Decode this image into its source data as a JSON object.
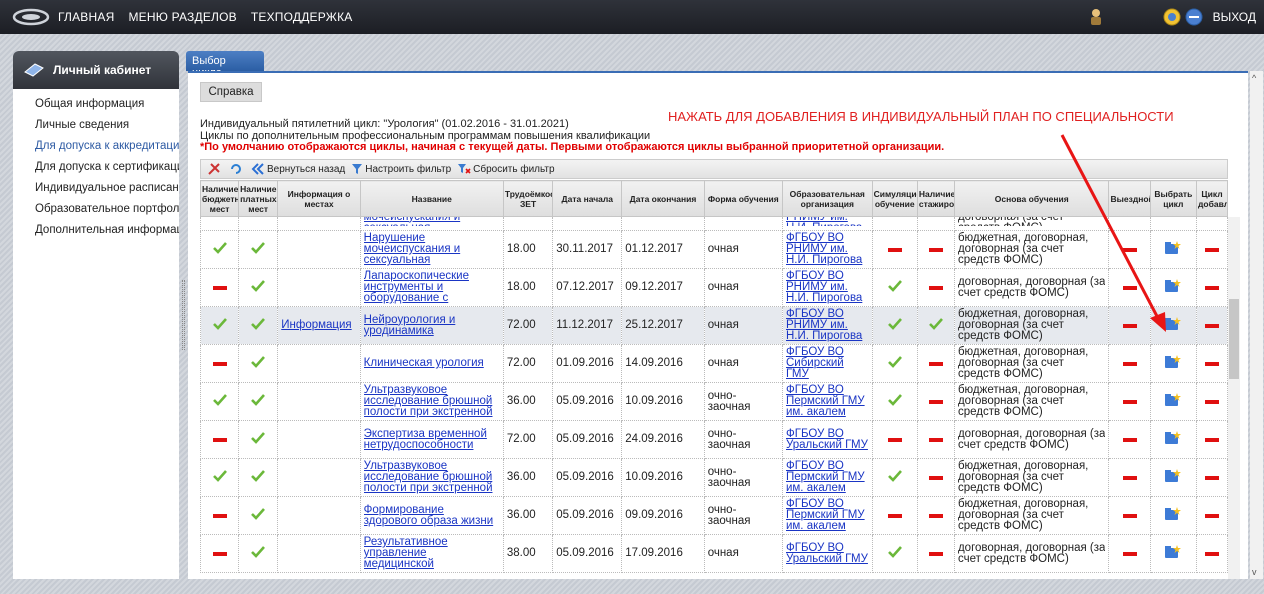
{
  "topbar": {
    "nav": [
      "ГЛАВНАЯ",
      "МЕНЮ РАЗДЕЛОВ",
      "ТЕХПОДДЕРЖКА"
    ],
    "exit_label": "ВЫХОД"
  },
  "sidebar": {
    "title": "Личный кабинет",
    "items": [
      "Общая информация",
      "Личные сведения",
      "Для допуска к аккредитации",
      "Для допуска к сертификации",
      "Индивидуальное расписание",
      "Образовательное портфолио",
      "Дополнительная информация"
    ],
    "active_index": 2
  },
  "tab": {
    "label": "Выбор цикла"
  },
  "help_button": "Справка",
  "info": {
    "line1": "Индивидуальный пятилетний цикл: \"Урология\" (01.02.2016 - 31.01.2021)",
    "line2": "Циклы по дополнительным профессиональным программам повышения квалификации",
    "warning": "*По умолчанию отображаются циклы, начиная с текущей даты. Первыми отображаются циклы выбранной приоритетной организации."
  },
  "annotation": "НАЖАТЬ ДЛЯ ДОБАВЛЕНИЯ В ИНДИВИДУАЛЬНЫЙ ПЛАН ПО СПЕЦИАЛЬНОСТИ",
  "toolbar": {
    "back": "Вернуться назад",
    "filter": "Настроить фильтр",
    "reset": "Сбросить фильтр"
  },
  "columns": [
    "Наличие бюджетных мест",
    "Наличие платных мест",
    "Информация о местах",
    "Название",
    "Трудоёмкость ЗЕТ",
    "Дата начала",
    "Дата окончания",
    "Форма обучения",
    "Образовательная организация",
    "Симуляционное обучение",
    "Наличие стажировки",
    "Основа обучения",
    "Выездной",
    "Выбрать цикл",
    "Цикл добавлен"
  ],
  "partial_row": {
    "name": "мочеиспускания и сексуальная",
    "org": "РНИМУ им. Н.И. Пирогова",
    "basis": "договорная (за счет средств ФОМС)"
  },
  "rows": [
    {
      "budget": true,
      "paid": true,
      "info": "",
      "name": "Нарушение мочеиспускания и сексуальная",
      "zet": "18.00",
      "start": "30.11.2017",
      "end": "01.12.2017",
      "form": "очная",
      "org": "ФГБОУ ВО РНИМУ им. Н.И. Пирогова",
      "sim": false,
      "intern": false,
      "basis": "бюджетная, договорная, договорная (за счет средств ФОМС)",
      "vyezd": false,
      "added": false
    },
    {
      "budget": false,
      "paid": true,
      "info": "",
      "name": "Лапароскопические инструменты и оборудование с",
      "zet": "18.00",
      "start": "07.12.2017",
      "end": "09.12.2017",
      "form": "очная",
      "org": "ФГБОУ ВО РНИМУ им. Н.И. Пирогова",
      "sim": true,
      "intern": false,
      "basis": "договорная, договорная (за счет средств ФОМС)",
      "vyezd": false,
      "added": false
    },
    {
      "budget": true,
      "paid": true,
      "info": "Информация",
      "name": "Нейроурология и уродинамика",
      "zet": "72.00",
      "start": "11.12.2017",
      "end": "25.12.2017",
      "form": "очная",
      "org": "ФГБОУ ВО РНИМУ им. Н.И. Пирогова",
      "sim": true,
      "intern": true,
      "basis": "бюджетная, договорная, договорная (за счет средств ФОМС)",
      "vyezd": false,
      "added": false
    },
    {
      "budget": false,
      "paid": true,
      "info": "",
      "name": "Клиническая урология",
      "zet": "72.00",
      "start": "01.09.2016",
      "end": "14.09.2016",
      "form": "очная",
      "org": "ФГБОУ ВО Сибирский ГМУ",
      "sim": true,
      "intern": false,
      "basis": "бюджетная, договорная, договорная (за счет средств ФОМС)",
      "vyezd": false,
      "added": false
    },
    {
      "budget": true,
      "paid": true,
      "info": "",
      "name": "Ультразвуковое исследование брюшной полости при экстренной",
      "zet": "36.00",
      "start": "05.09.2016",
      "end": "10.09.2016",
      "form": "очно-заочная",
      "org": "ФГБОУ ВО Пермский ГМУ им. акалем",
      "sim": true,
      "intern": false,
      "basis": "бюджетная, договорная, договорная (за счет средств ФОМС)",
      "vyezd": false,
      "added": false
    },
    {
      "budget": false,
      "paid": true,
      "info": "",
      "name": "Экспертиза временной нетрудоспособности",
      "zet": "72.00",
      "start": "05.09.2016",
      "end": "24.09.2016",
      "form": "очно-заочная",
      "org": "ФГБОУ ВО Уральский ГМУ",
      "sim": false,
      "intern": false,
      "basis": "договорная, договорная (за счет средств ФОМС)",
      "vyezd": false,
      "added": false
    },
    {
      "budget": true,
      "paid": true,
      "info": "",
      "name": "Ультразвуковое исследование брюшной полости при экстренной",
      "zet": "36.00",
      "start": "05.09.2016",
      "end": "10.09.2016",
      "form": "очно-заочная",
      "org": "ФГБОУ ВО Пермский ГМУ им. акалем",
      "sim": true,
      "intern": false,
      "basis": "бюджетная, договорная, договорная (за счет средств ФОМС)",
      "vyezd": false,
      "added": false
    },
    {
      "budget": false,
      "paid": true,
      "info": "",
      "name": "Формирование здорового образа жизни",
      "zet": "36.00",
      "start": "05.09.2016",
      "end": "09.09.2016",
      "form": "очно-заочная",
      "org": "ФГБОУ ВО Пермский ГМУ им. акалем",
      "sim": false,
      "intern": false,
      "basis": "бюджетная, договорная, договорная (за счет средств ФОМС)",
      "vyezd": false,
      "added": false
    },
    {
      "budget": false,
      "paid": true,
      "info": "",
      "name": "Результативное управление медицинской",
      "zet": "38.00",
      "start": "05.09.2016",
      "end": "17.09.2016",
      "form": "очная",
      "org": "ФГБОУ ВО Уральский ГМУ",
      "sim": true,
      "intern": false,
      "basis": "договорная, договорная (за счет средств ФОМС)",
      "vyezd": false,
      "added": false
    }
  ],
  "colors": {
    "accent": "#2b5ea4",
    "link": "#1a35c4",
    "warn": "#e00000",
    "check": "#6bb83a"
  }
}
